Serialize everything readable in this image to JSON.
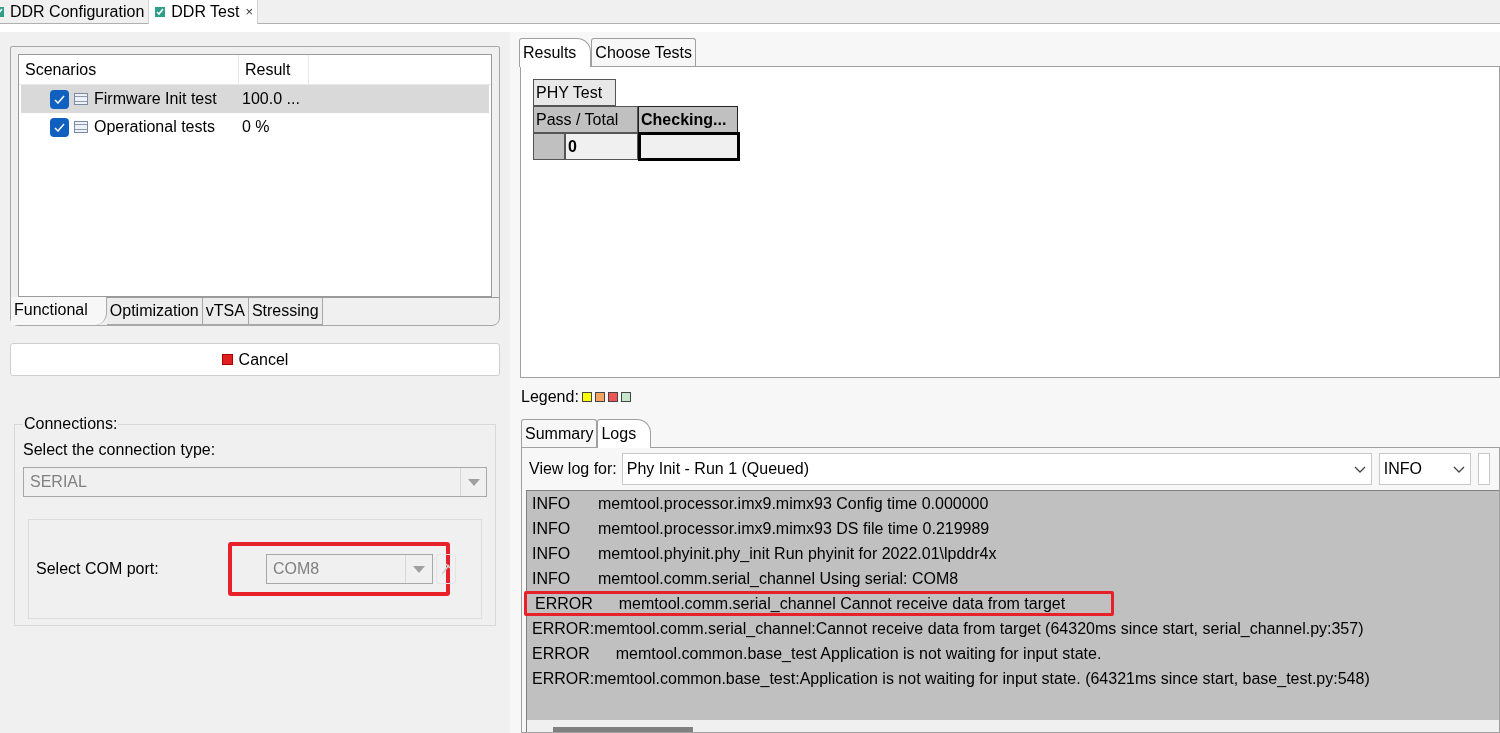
{
  "editor_tabs": [
    {
      "label": "DDR Configuration",
      "selected": false
    },
    {
      "label": "DDR Test",
      "selected": true,
      "close": "×"
    }
  ],
  "scenarios": {
    "columns": [
      "Scenarios",
      "Result"
    ],
    "rows": [
      {
        "name": "Firmware Init test",
        "result": "100.0 ...",
        "checked": true,
        "selected": true
      },
      {
        "name": "Operational tests",
        "result": "0 %",
        "checked": true,
        "selected": false
      }
    ],
    "tabs": [
      {
        "label": "Functional",
        "selected": true
      },
      {
        "label": "Optimization",
        "selected": false
      },
      {
        "label": "vTSA",
        "selected": false
      },
      {
        "label": "Stressing",
        "selected": false
      }
    ]
  },
  "cancel_button": "Cancel",
  "connections": {
    "title": "Connections:",
    "type_label": "Select the connection type:",
    "type_value": "SERIAL",
    "port_label": "Select COM port:",
    "port_value": "COM8",
    "disabled": true,
    "port_highlighted": true
  },
  "result_tabs": [
    {
      "label": "Results",
      "selected": true
    },
    {
      "label": "Choose Tests",
      "selected": false
    }
  ],
  "phy_test": {
    "title": "PHY Test",
    "columns": [
      "Pass / Total",
      "Checking..."
    ],
    "pass": "0"
  },
  "legend": {
    "label": "Legend:",
    "items": [
      {
        "color": "#ffff00"
      },
      {
        "color": "#f4a460"
      },
      {
        "color": "#ee5555"
      },
      {
        "color": "#c8e6c9"
      }
    ]
  },
  "log_tabs": [
    {
      "label": "Summary",
      "selected": false
    },
    {
      "label": "Logs",
      "selected": true
    }
  ],
  "log_filter": {
    "label": "View log for:",
    "run": "Phy Init - Run 1 (Queued)",
    "level": "INFO"
  },
  "log_lines": [
    {
      "kind": "entry",
      "level": "INFO",
      "message": "memtool.processor.imx9.mimx93 Config time 0.000000",
      "highlighted": false
    },
    {
      "kind": "entry",
      "level": "INFO",
      "message": "memtool.processor.imx9.mimx93 DS file time 0.219989",
      "highlighted": false
    },
    {
      "kind": "entry",
      "level": "INFO",
      "message": "memtool.phyinit.phy_init Run phyinit for 2022.01\\lpddr4x",
      "highlighted": false
    },
    {
      "kind": "entry",
      "level": "INFO",
      "message": "memtool.comm.serial_channel Using serial: COM8",
      "highlighted": false
    },
    {
      "kind": "entry",
      "level": "ERROR",
      "message": "memtool.comm.serial_channel Cannot receive data from target",
      "highlighted": true
    },
    {
      "kind": "raw",
      "text": "ERROR:memtool.comm.serial_channel:Cannot receive data from target (64320ms since start, serial_channel.py:357)",
      "highlighted": false
    },
    {
      "kind": "entry",
      "level": "ERROR",
      "message": "memtool.common.base_test Application is not waiting for input state.",
      "highlighted": false
    },
    {
      "kind": "raw",
      "text": "ERROR:memtool.common.base_test:Application is not waiting for input state. (64321ms since start, base_test.py:548)",
      "highlighted": false
    }
  ]
}
